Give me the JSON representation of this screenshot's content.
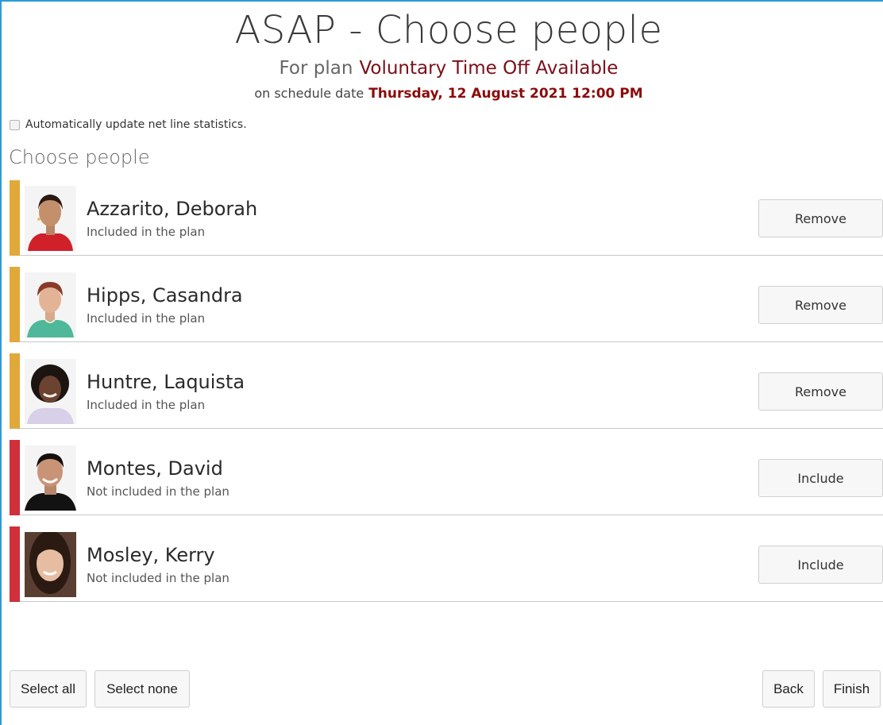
{
  "header": {
    "title": "ASAP - Choose people",
    "plan_prefix": "For plan",
    "plan_name": "Voluntary Time Off Available",
    "date_prefix": "on schedule date",
    "date_value": "Thursday, 12 August 2021 12:00 PM"
  },
  "options": {
    "auto_update_label": "Automatically update net line statistics.",
    "auto_update_checked": false
  },
  "section_heading": "Choose people",
  "colors": {
    "included_bar": "#e0a93a",
    "not_included_bar": "#d0303b",
    "accent_border": "#2b9bd6",
    "plan_name": "#7a0f1a",
    "date_value": "#8b0a0a"
  },
  "people": [
    {
      "name": "Azzarito, Deborah",
      "status": "Included in the plan",
      "button": "Remove",
      "included": true
    },
    {
      "name": "Hipps, Casandra",
      "status": "Included in the plan",
      "button": "Remove",
      "included": true
    },
    {
      "name": "Huntre, Laquista",
      "status": "Included in the plan",
      "button": "Remove",
      "included": true
    },
    {
      "name": "Montes, David",
      "status": "Not included in the plan",
      "button": "Include",
      "included": false
    },
    {
      "name": "Mosley, Kerry",
      "status": "Not included in the plan",
      "button": "Include",
      "included": false
    }
  ],
  "footer": {
    "select_all": "Select all",
    "select_none": "Select none",
    "back": "Back",
    "finish": "Finish"
  }
}
